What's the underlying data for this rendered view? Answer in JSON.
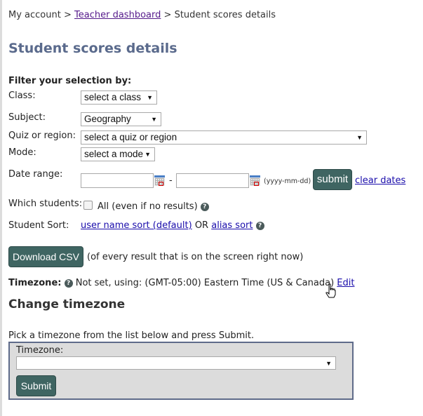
{
  "breadcrumb": {
    "items": [
      {
        "label": "My account",
        "link": false
      },
      {
        "label": "Teacher dashboard",
        "link": true
      },
      {
        "label": "Student scores details",
        "link": false
      }
    ],
    "separator": ">"
  },
  "page_title": "Student scores details",
  "filter": {
    "heading": "Filter your selection by:",
    "class": {
      "label": "Class:",
      "value": "select a class"
    },
    "subject": {
      "label": "Subject:",
      "value": "Geography"
    },
    "quiz": {
      "label": "Quiz or region:",
      "value": "select a quiz or region"
    },
    "mode": {
      "label": "Mode:",
      "value": "select a mode"
    },
    "date_range": {
      "label": "Date range:",
      "start_value": "",
      "end_value": "",
      "separator": "-",
      "format_hint": "(yyyy-mm-dd)",
      "submit_label": "submit",
      "clear_label": "clear dates"
    },
    "which_students": {
      "label": "Which students:",
      "checkbox_label": "All (even if no results)",
      "checked": false,
      "help": "?"
    },
    "student_sort": {
      "label": "Student Sort:",
      "option1": "user name sort (default)",
      "or": "OR",
      "option2": "alias sort",
      "help": "?"
    }
  },
  "download": {
    "button_label": "Download CSV",
    "note": "(of every result that is on the screen right now)"
  },
  "timezone": {
    "label": "Timezone:",
    "help": "?",
    "status": "Not set, using: (GMT-05:00) Eastern Time (US & Canada)",
    "edit_label": "Edit"
  },
  "change_timezone": {
    "heading": "Change timezone",
    "instruction": "Pick a timezone from the list below and press Submit.",
    "field_label": "Timezone:",
    "field_value": "",
    "submit_label": "Submit"
  }
}
